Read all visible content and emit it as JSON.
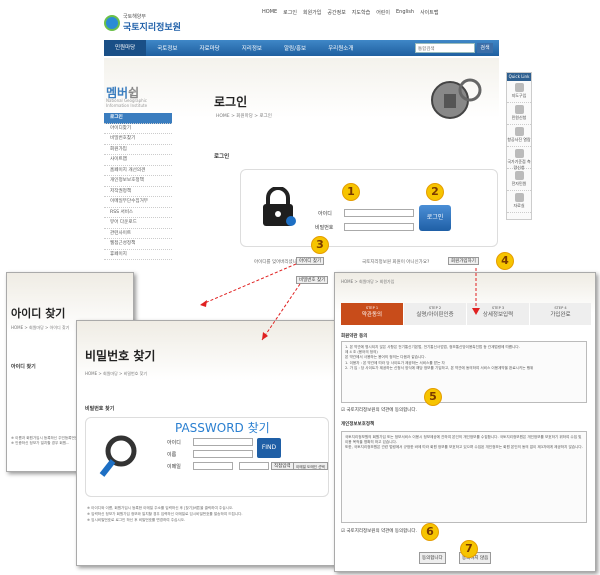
{
  "site": {
    "org": "국토해양부",
    "name": "국토지리정보원"
  },
  "util": [
    "HOME",
    "로그인",
    "회원가입",
    "공간정보",
    "지도학습",
    "어린이",
    "English",
    "사이트맵"
  ],
  "gnb": [
    "민원마당",
    "국토정보",
    "자료마당",
    "지리정보",
    "알림/홍보",
    "우리원소개"
  ],
  "search": {
    "placeholder": "통합검색",
    "button": "검색"
  },
  "sidebar": {
    "title": "멤버",
    "title_sub": "쉽",
    "subtitle": "National Geographic Information Institute",
    "items": [
      "로그인",
      "아이디찾기",
      "비밀번호찾기",
      "회원가입",
      "사이트맵",
      "홈페이지 개선의견",
      "개인정보보호정책",
      "저작권정책",
      "이메일무단수집거부",
      "RSS 서비스",
      "뷰어 다운로드",
      "관련사이트",
      "웹접근성정책",
      "휴페이지"
    ]
  },
  "main": {
    "title": "로그인",
    "breadcrumb": "HOME > 회원마당 > 로그인",
    "section": "로그인",
    "id_label": "아이디",
    "pw_label": "비밀번호",
    "login_btn": "로그인",
    "hint1": "아이디를 잊어버리셨나요?",
    "find_id_btn": "아이디 찾기",
    "hint2": "비밀번호를 잊어버리셨나요?",
    "find_pw_btn": "비밀번호 찾기",
    "hint3": "국토지리정보원 회원이 아니신가요?",
    "join_btn": "회원가입하기"
  },
  "quick": {
    "title": "Quick Link",
    "items": [
      "지도구입",
      "민원신청",
      "항공사진\n열람",
      "국가기준점\n측량신청",
      "전자민원",
      "자료실"
    ]
  },
  "numbers": [
    "1",
    "2",
    "3",
    "4",
    "5",
    "6",
    "7"
  ],
  "find_id": {
    "title": "아이디 찾기",
    "breadcrumb": "HOME > 회원마당 > 아이디 찾기",
    "section": "아이디 찾기",
    "note": "※ 이름과 회원가입시 등록하신 주민등록번호를\n※ 인증하신 정보가 일치할 경우 회원..."
  },
  "find_pw": {
    "title": "비밀번호 찾기",
    "breadcrumb": "HOME > 회원마당 > 비밀번호 찾기",
    "section": "비밀번호 찾기",
    "heading": "PASSWORD 찾기",
    "id_label": "아이디",
    "name_label": "이름",
    "email_label": "이메일",
    "find_btn": "FIND",
    "direct": "직접입력",
    "select_opt": "이메일 도메인 선택",
    "notes": [
      "※ 아이디와 이름, 회원가입시 등록한 이메일 주소를 입력하신 후 [찾기]버튼을 클릭하여 주십시오.",
      "※ 입력하신 정보가 회원가입 정보와 일치할 경우 입력하신 이메일로 임시비밀번호를 발송하여 드립니다.",
      "※ 임시비밀번호로 로그인 하신 후 비밀번호를 변경하여 주십시오."
    ]
  },
  "join": {
    "breadcrumb": "HOME > 회원마당 > 회원가입",
    "steps": [
      {
        "n": "STEP 1",
        "t": "약관동의"
      },
      {
        "n": "STEP 2",
        "t": "실명/아이핀인증"
      },
      {
        "n": "STEP 3",
        "t": "상세정보입력"
      },
      {
        "n": "STEP 4",
        "t": "가입완료"
      }
    ],
    "terms_title": "회원약관 동의",
    "terms_text": "1. 본 약관에 명시되지 않은 사항은 전기통신기본법, 전기통신사업법, 정보통신망이용촉진법 등 관계법령에 따릅니다.\n제 4 조 (용어의 정의)\n본 약관에서 사용하는 용어의 정의는 다음과 같습니다.\n1. 이용자 : 본 약관에 따라 당 사이트가 제공하는 서비스를 받는 자\n2. 가 입 : 당 사이트가 제공하는 신청서 양식에 해당 정보를 기입하고, 본 약관에 동의하여 서비스 이용계약을 완료시키는 행위",
    "agree1": "국토지리정보원의 약관에 동의합니다.",
    "privacy_title": "개인정보보호정책",
    "privacy_text": "국토지리정보원의 회원가입 또는 정보서비스 이용시 정보제공에 관하여 본인의 개인정보를 수집합니다. 국토지리정보원은 개인정보를 보호하기 위하여 수집 및 이용 목적을 명확히 하고 있습니다.\n또한, 국토지리정보원은 관련 법령에서 규정한 바에 따라 회원 정보를 보호하고 있으며 수집된 개인정보는 회원 본인의 동의 없이 제3자에게 제공하지 않습니다.",
    "agree2": "국토지리정보원의 약관에 동의합니다.",
    "agree_btn": "동의합니다",
    "disagree_btn": "동의하지 않음"
  },
  "colors": {
    "brand": "#1f5fa6",
    "step_active": "#c84c1a",
    "marker": "#f6c400",
    "arrow": "#e02020"
  }
}
